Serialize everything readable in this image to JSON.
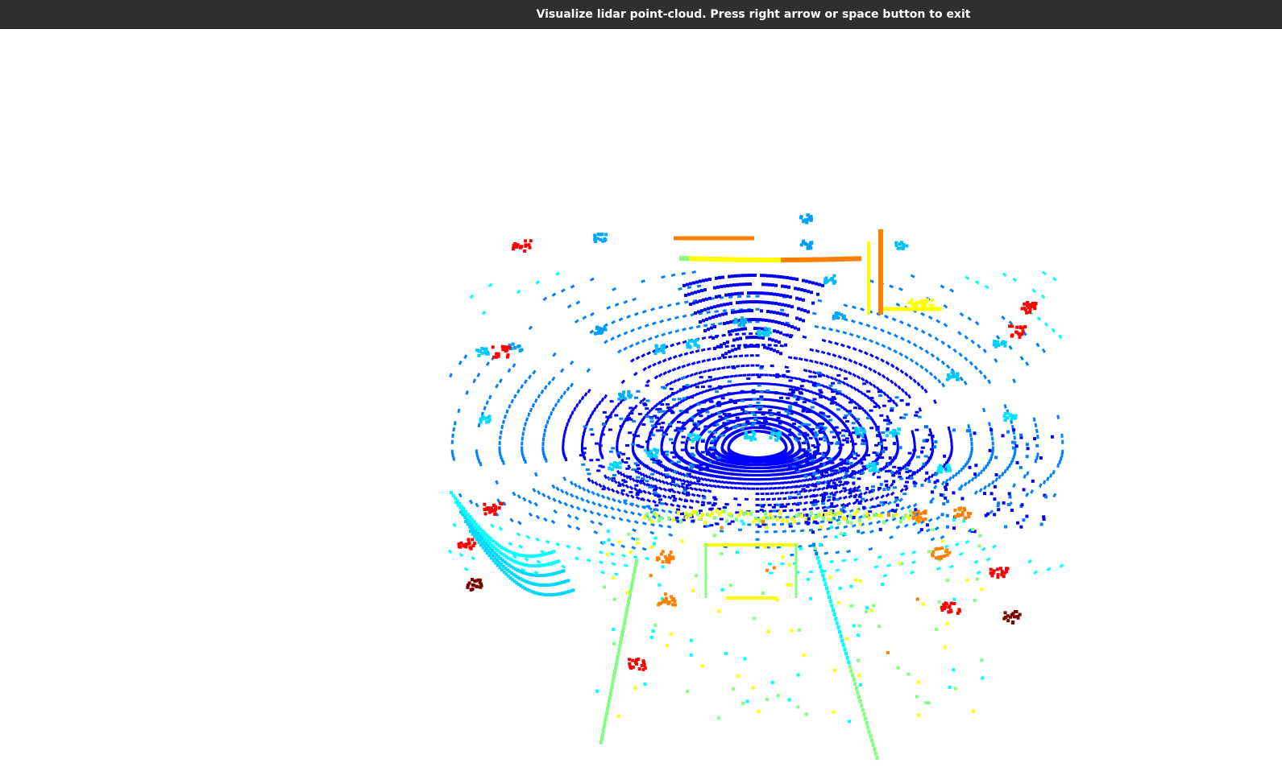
{
  "window": {
    "title": "Visualize lidar point-cloud. Press right arrow or space button to exit"
  },
  "canvas": {
    "background": "#ffffff",
    "colormap": "jet",
    "colors": [
      "#00008f",
      "#0000ff",
      "#0080ff",
      "#00ffff",
      "#80ff80",
      "#ffff00",
      "#ff8000",
      "#ff0000",
      "#800000"
    ]
  }
}
